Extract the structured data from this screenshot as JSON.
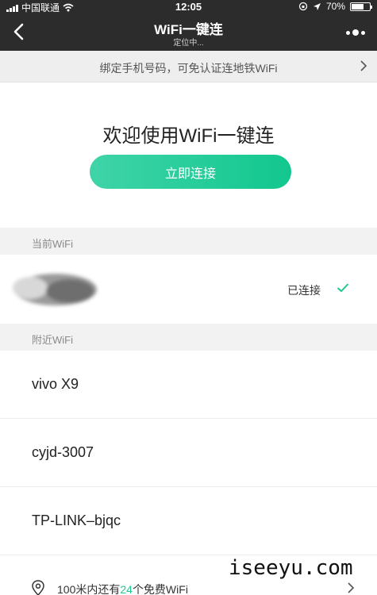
{
  "status_bar": {
    "carrier": "中国联通",
    "time": "12:05",
    "battery": "70%",
    "battery_level": 0.7
  },
  "nav": {
    "title": "WiFi一键连",
    "subtitle": "定位中..."
  },
  "banner": {
    "text": "绑定手机号码，可免认证连地铁WiFi"
  },
  "hero": {
    "welcome": "欢迎使用WiFi一键连",
    "connect_button": "立即连接"
  },
  "current": {
    "section_label": "当前WiFi",
    "status": "已连接"
  },
  "nearby": {
    "section_label": "附近WiFi",
    "networks": [
      "vivo X9",
      "cyjd-3007",
      "TP-LINK–bjqc"
    ]
  },
  "footer": {
    "prefix": "100米内还有",
    "count": "24",
    "suffix": "个免费WiFi"
  },
  "watermark": "iseeyu.com",
  "colors": {
    "accent": "#1fc98e",
    "nav_bg": "#2c2c2c"
  }
}
